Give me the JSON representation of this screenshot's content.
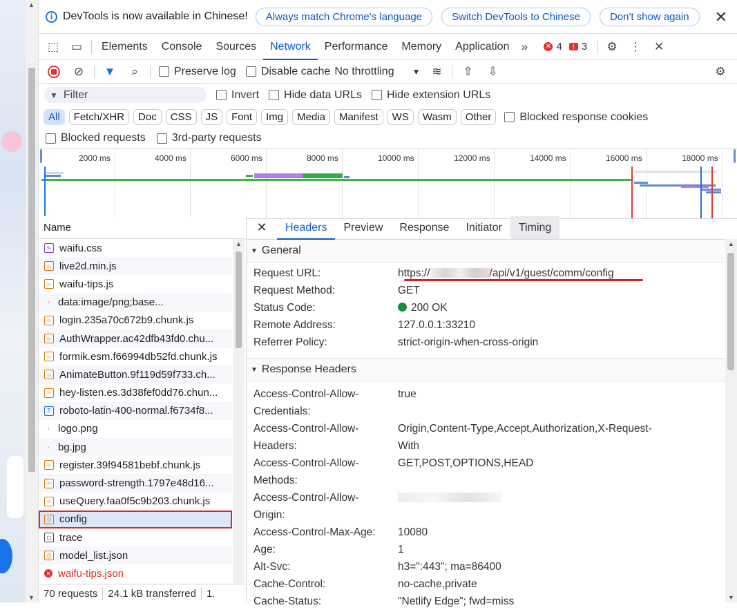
{
  "infobar": {
    "message": "DevTools is now available in Chinese!",
    "btn_match": "Always match Chrome's language",
    "btn_switch": "Switch DevTools to Chinese",
    "btn_dont": "Don't show again"
  },
  "tabs": [
    "Elements",
    "Console",
    "Sources",
    "Network",
    "Performance",
    "Memory",
    "Application"
  ],
  "active_tab": "Network",
  "error_count": "4",
  "warning_count": "3",
  "toolbar": {
    "preserve_log": "Preserve log",
    "disable_cache": "Disable cache",
    "throttling": "No throttling"
  },
  "filter": {
    "placeholder": "Filter",
    "invert": "Invert",
    "hide_data_urls": "Hide data URLs",
    "hide_extension_urls": "Hide extension URLs"
  },
  "chips": [
    "All",
    "Fetch/XHR",
    "Doc",
    "CSS",
    "JS",
    "Font",
    "Img",
    "Media",
    "Manifest",
    "WS",
    "Wasm",
    "Other"
  ],
  "blocked_response_cookies": "Blocked response cookies",
  "blocked_requests": "Blocked requests",
  "third_party": "3rd-party requests",
  "timeline_labels": [
    "2000 ms",
    "4000 ms",
    "6000 ms",
    "8000 ms",
    "10000 ms",
    "12000 ms",
    "14000 ms",
    "16000 ms",
    "18000 ms"
  ],
  "name_header": "Name",
  "requests": [
    {
      "name": "waifu.css",
      "icon": "css"
    },
    {
      "name": "live2d.min.js",
      "icon": "js"
    },
    {
      "name": "waifu-tips.js",
      "icon": "js"
    },
    {
      "name": "data:image/png;base...",
      "icon": "img"
    },
    {
      "name": "login.235a70c672b9.chunk.js",
      "icon": "js"
    },
    {
      "name": "AuthWrapper.ac42dfb43fd0.chu...",
      "icon": "js"
    },
    {
      "name": "formik.esm.f66994db52fd.chunk.js",
      "icon": "js"
    },
    {
      "name": "AnimateButton.9f119d59f733.ch...",
      "icon": "js"
    },
    {
      "name": "hey-listen.es.3d38fef0dd76.chun...",
      "icon": "js"
    },
    {
      "name": "roboto-latin-400-normal.f6734f8...",
      "icon": "font"
    },
    {
      "name": "logo.png",
      "icon": "img"
    },
    {
      "name": "bg.jpg",
      "icon": "img"
    },
    {
      "name": "register.39f94581bebf.chunk.js",
      "icon": "js"
    },
    {
      "name": "password-strength.1797e48d16...",
      "icon": "js"
    },
    {
      "name": "useQuery.faa0f5c9b203.chunk.js",
      "icon": "js"
    },
    {
      "name": "config",
      "icon": "json"
    },
    {
      "name": "trace",
      "icon": "doc"
    },
    {
      "name": "model_list.json",
      "icon": "json"
    },
    {
      "name": "waifu-tips.json",
      "icon": "err"
    }
  ],
  "status": {
    "requests": "70 requests",
    "transferred": "24.1 kB transferred",
    "more": "1."
  },
  "detail_tabs": [
    "Headers",
    "Preview",
    "Response",
    "Initiator",
    "Timing"
  ],
  "general": {
    "title": "General",
    "rows": [
      {
        "k": "Request URL:",
        "v_prefix": "https://",
        "v_suffix": "/api/v1/guest/comm/config"
      },
      {
        "k": "Request Method:",
        "v": "GET"
      },
      {
        "k": "Status Code:",
        "v": "200 OK"
      },
      {
        "k": "Remote Address:",
        "v": "127.0.0.1:33210"
      },
      {
        "k": "Referrer Policy:",
        "v": "strict-origin-when-cross-origin"
      }
    ]
  },
  "response_headers": {
    "title": "Response Headers",
    "rows": [
      {
        "k": "Access-Control-Allow-\nCredentials:",
        "v": "true"
      },
      {
        "k": "Access-Control-Allow-\nHeaders:",
        "v": "Origin,Content-Type,Accept,Authorization,X-Request-\nWith"
      },
      {
        "k": "Access-Control-Allow-\nMethods:",
        "v": "GET,POST,OPTIONS,HEAD"
      },
      {
        "k": "Access-Control-Allow-\nOrigin:",
        "v": ""
      },
      {
        "k": "Access-Control-Max-Age:",
        "v": "10080"
      },
      {
        "k": "Age:",
        "v": "1"
      },
      {
        "k": "Alt-Svc:",
        "v": "h3=\":443\"; ma=86400"
      },
      {
        "k": "Cache-Control:",
        "v": "no-cache,private"
      },
      {
        "k": "Cache-Status:",
        "v": "\"Netlify Edge\"; fwd=miss"
      }
    ]
  }
}
